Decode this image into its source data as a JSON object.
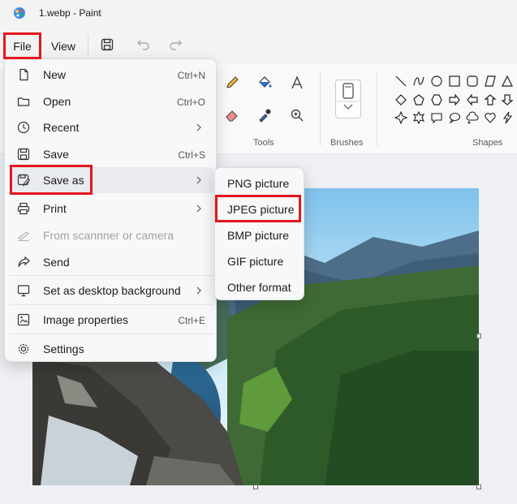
{
  "window": {
    "title": "1.webp - Paint"
  },
  "menubar": {
    "file": "File",
    "view": "View"
  },
  "ribbon": {
    "tools_label": "Tools",
    "brushes_label": "Brushes",
    "shapes_label": "Shapes"
  },
  "file_menu": {
    "items": [
      {
        "label": "New",
        "shortcut": "Ctrl+N",
        "icon": "new-file-icon"
      },
      {
        "label": "Open",
        "shortcut": "Ctrl+O",
        "icon": "open-folder-icon"
      },
      {
        "label": "Recent",
        "shortcut": "",
        "icon": "clock-icon",
        "submenu": true
      },
      {
        "label": "Save",
        "shortcut": "Ctrl+S",
        "icon": "save-icon"
      },
      {
        "label": "Save as",
        "shortcut": "",
        "icon": "save-as-icon",
        "submenu": true
      },
      {
        "label": "Print",
        "shortcut": "",
        "icon": "printer-icon",
        "submenu": true
      },
      {
        "label": "From scannner or camera",
        "shortcut": "",
        "icon": "scanner-icon",
        "disabled": true
      },
      {
        "label": "Send",
        "shortcut": "",
        "icon": "share-icon"
      },
      {
        "label": "Set as desktop background",
        "shortcut": "",
        "icon": "desktop-icon",
        "submenu": true
      },
      {
        "label": "Image properties",
        "shortcut": "Ctrl+E",
        "icon": "image-properties-icon"
      },
      {
        "label": "Settings",
        "shortcut": "",
        "icon": "gear-icon"
      }
    ]
  },
  "save_as_submenu": {
    "items": [
      "PNG picture",
      "JPEG picture",
      "BMP picture",
      "GIF picture",
      "Other format"
    ]
  },
  "colors": {
    "highlight": "#e4161f",
    "accent": "#1a73c8"
  }
}
